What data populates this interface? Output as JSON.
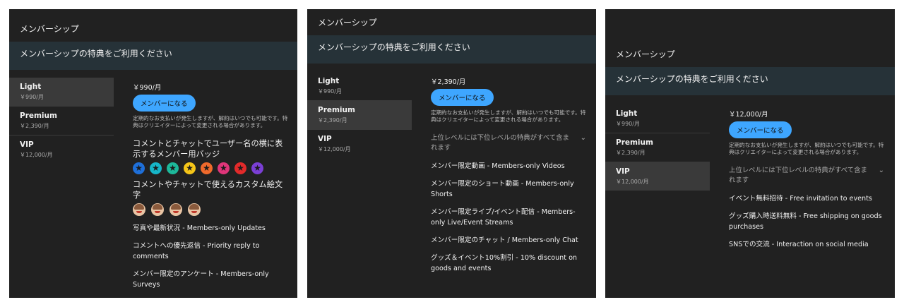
{
  "header_title": "メンバーシップ",
  "banner_text": "メンバーシップの特典をご利用ください",
  "tiers": [
    {
      "name": "Light",
      "price": "￥990/月"
    },
    {
      "name": "Premium",
      "price": "￥2,390/月"
    },
    {
      "name": "VIP",
      "price": "￥12,000/月"
    }
  ],
  "join_label": "メンバーになる",
  "note": "定期的なお支払いが発生しますが、解約はいつでも可能です。特典はクリエイターによって変更される場合があります。",
  "upper_levels_note": "上位レベルには下位レベルの特典がすべて含まれます",
  "panels": [
    {
      "selected_tier": "Light",
      "price": "￥990/月",
      "badges_title": "コメントとチャットでユーザー名の横に表示するメンバー用バッジ",
      "badge_colors": [
        "#1e6fd9",
        "#16b5c8",
        "#1db89a",
        "#f5c518",
        "#f06a2c",
        "#e0357a",
        "#e32a2a",
        "#7b3fd6"
      ],
      "emoji_title": "コメントやチャットで使えるカスタム絵文字",
      "benefits": [
        "写真や最新状況 - Members-only Updates",
        "コメントへの優先返信 - Priority reply to comments",
        "メンバー限定のアンケート - Members-only Surveys"
      ]
    },
    {
      "selected_tier": "Premium",
      "price": "￥2,390/月",
      "benefits": [
        "メンバー限定動画 - Members-only Videos",
        "メンバー限定のショート動画 - Members-only Shorts",
        "メンバー限定ライブ/イベント配信 - Members-only Live/Event Streams",
        "メンバー限定のチャット / Members-only Chat",
        "グッズ＆イベント10%割引 - 10% discount on goods and events"
      ]
    },
    {
      "selected_tier": "VIP",
      "price": "￥12,000/月",
      "benefits": [
        "イベント無料招待 - Free invitation to events",
        "グッズ購入時送料無料 - Free shipping on goods purchases",
        "SNSでの交流 - Interaction on social media"
      ]
    }
  ]
}
